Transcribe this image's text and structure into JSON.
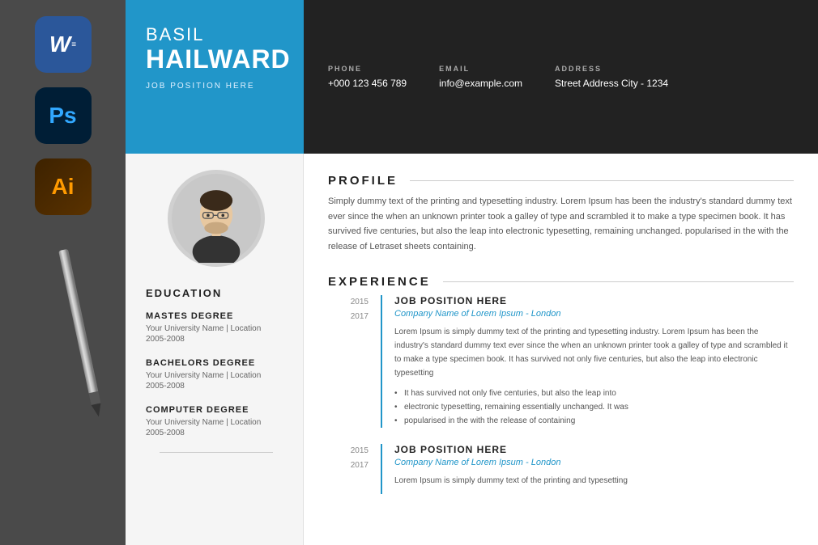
{
  "app_icons": [
    {
      "id": "word",
      "label": "W",
      "sub": "≡",
      "color_bg": "#2b579a",
      "color_text": "white"
    },
    {
      "id": "photoshop",
      "label": "Ps",
      "color_bg": "#001e36",
      "color_text": "#31a8ff"
    },
    {
      "id": "illustrator",
      "label": "Ai",
      "color_bg": "#3d2200",
      "color_text": "#ff9a00"
    }
  ],
  "header": {
    "first_name": "BASIL",
    "last_name": "HAILWARD",
    "job_title": "JOB POSITION HERE",
    "phone_label": "PHONE",
    "phone_value": "+000 123 456 789",
    "email_label": "EMAIL",
    "email_value": "info@example.com",
    "address_label": "ADDRESS",
    "address_value": "Street Address City - 1234"
  },
  "left_col": {
    "education_title": "EDUCATION",
    "degrees": [
      {
        "degree": "MASTES DEGREE",
        "school": "Your University Name | Location",
        "years": "2005-2008"
      },
      {
        "degree": "BACHELORS DEGREE",
        "school": "Your University Name | Location",
        "years": "2005-2008"
      },
      {
        "degree": "COMPUTER DEGREE",
        "school": "Your University Name | Location",
        "years": "2005-2008"
      }
    ]
  },
  "right_col": {
    "profile_title": "PROFILE",
    "profile_text": "Simply dummy text of the printing and typesetting industry. Lorem Ipsum has been the industry's standard dummy text ever since the when an unknown printer took a galley of type and scrambled it to make a type specimen book. It has survived five centuries, but also the leap into electronic typesetting, remaining unchanged. popularised in the with the release of Letraset sheets containing.",
    "experience_title": "EXPERIENCE",
    "experiences": [
      {
        "year_start": "2015",
        "year_end": "2017",
        "position": "JOB POSITION HERE",
        "company": "Company Name of Lorem Ipsum - London",
        "desc": "Lorem Ipsum is simply dummy text of the printing and typesetting industry. Lorem Ipsum has been the industry's standard dummy text ever since the when an unknown printer took a galley of type and scrambled it to make a type specimen book. It has survived not only five centuries, but also the leap into electronic typesetting",
        "bullets": [
          "It has survived not only five centuries, but also the leap into",
          "electronic typesetting, remaining essentially unchanged. It was",
          "popularised in the with the release of containing"
        ]
      },
      {
        "year_start": "2015",
        "year_end": "2017",
        "position": "JOB POSITION HERE",
        "company": "Company Name of Lorem Ipsum - London",
        "desc": "Lorem Ipsum is simply dummy text of the printing and typesetting",
        "bullets": []
      }
    ]
  }
}
